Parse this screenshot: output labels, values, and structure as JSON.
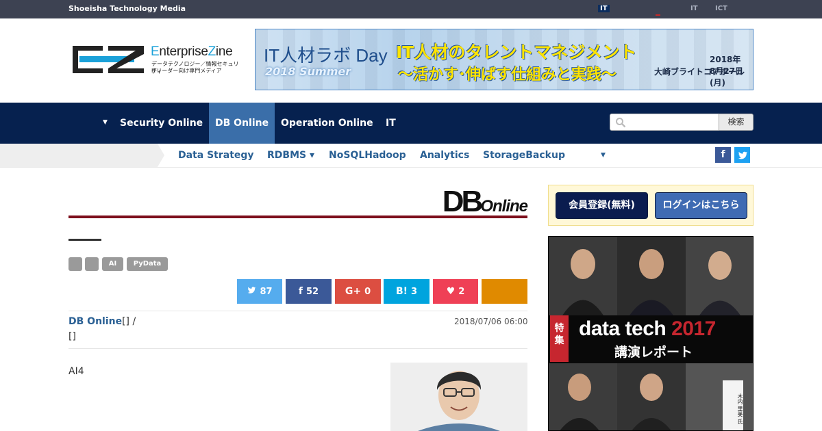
{
  "topbar": {
    "brand": "Shoeisha Technology Media",
    "switch_it_active": "IT",
    "switch_it": "IT",
    "switch_ict": "ICT"
  },
  "logo": {
    "name_prefix": "E",
    "name_mid": "nterprise",
    "name_z": "Z",
    "name_suffix": "ine",
    "tagline1": "データテクノロジー／情報セキュリティ",
    "tagline2": "ITリーダー向け専門メディア"
  },
  "banner": {
    "event": "IT人材ラボ Day",
    "season": "2018 Summer",
    "headline1": "IT人材のタレントマネジメント",
    "headline2": "〜活かす･伸ばす仕組みと実践〜",
    "date": "2018年8月27日(月)",
    "venue": "大崎ブライトコアホール"
  },
  "mainnav": {
    "items": [
      "Security Online",
      "DB Online",
      "Operation Online",
      "IT"
    ],
    "active": "DB Online",
    "search_button": "検索"
  },
  "subnav": {
    "items": [
      "Data Strategy",
      "RDBMS ▾",
      "NoSQLHadoop",
      "Analytics",
      "StorageBackup"
    ],
    "facebook": "f",
    "twitter": "t"
  },
  "article": {
    "section_logo_big": "DB",
    "section_logo_small": "Online",
    "tags": [
      "",
      "",
      "AI",
      "PyData"
    ],
    "share": [
      {
        "icon": "🐦",
        "count": "87"
      },
      {
        "icon": "f",
        "count": "52"
      },
      {
        "icon": "G+",
        "count": "0"
      },
      {
        "icon": "B!",
        "count": "3"
      },
      {
        "icon": "♥",
        "count": "2"
      },
      {
        "icon": "",
        "count": ""
      }
    ],
    "author_link": "DB Online",
    "author_rest": "[]   /",
    "author_line2": "[]",
    "date": "2018/07/06 06:00",
    "lead": "AI4"
  },
  "sidebar": {
    "register": "会員登録(無料)",
    "login": "ログインはこちら",
    "ad_tokushu": "特集",
    "ad_title": "data tech",
    "ad_year": "2017",
    "ad_sub": "講演レポート",
    "ad_tent": "木内 里美 氏"
  },
  "colors": {
    "topbar": "#3d4252",
    "mainnav": "#06214f",
    "active_nav": "#3a6ea9",
    "section_rule": "#7d0f1c",
    "share_twitter": "#55acee",
    "share_facebook": "#3b5998",
    "share_google": "#dc4e41",
    "share_hatena": "#00a4de",
    "share_pocket": "#ef4056",
    "share_other": "#e08a00"
  }
}
